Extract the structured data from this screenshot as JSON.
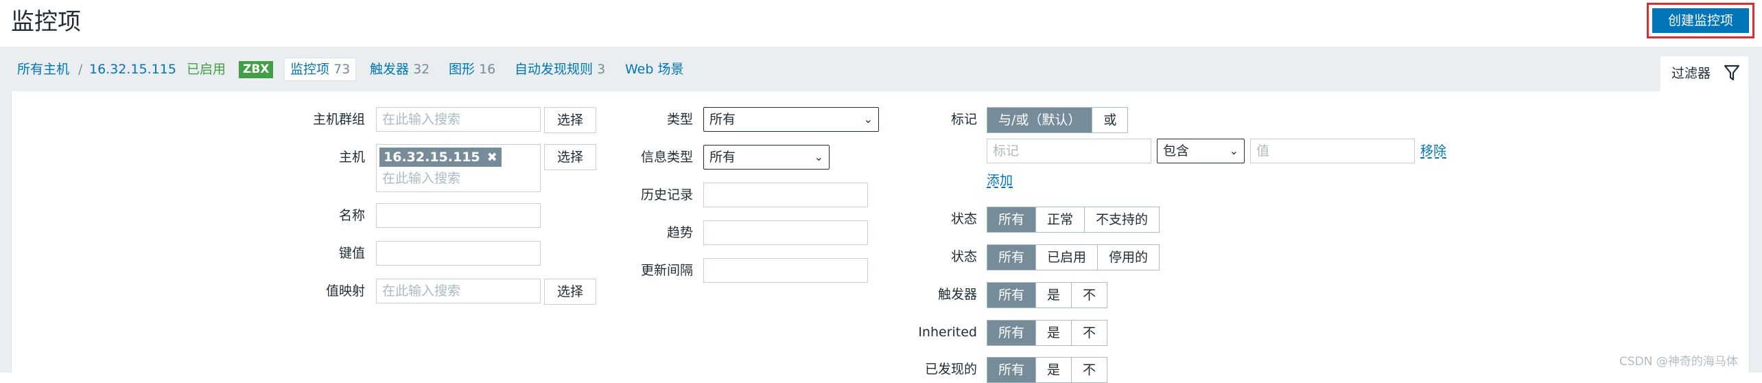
{
  "page": {
    "title": "监控项",
    "create_button": "创建监控项"
  },
  "breadcrumb": {
    "all_hosts": "所有主机",
    "separator": "/",
    "host": "16.32.15.115",
    "status": "已启用",
    "zbx": "ZBX",
    "items_label": "监控项",
    "items_count": "73",
    "triggers_label": "触发器",
    "triggers_count": "32",
    "graphs_label": "图形",
    "graphs_count": "16",
    "discovery_label": "自动发现规则",
    "discovery_count": "3",
    "web_label": "Web 场景"
  },
  "filter": {
    "tab_label": "过滤器",
    "host_group_label": "主机群组",
    "host_group_placeholder": "在此输入搜索",
    "select_label": "选择",
    "host_label": "主机",
    "host_chip": "16.32.15.115",
    "host_placeholder": "在此输入搜索",
    "name_label": "名称",
    "key_label": "键值",
    "valuemap_label": "值映射",
    "valuemap_placeholder": "在此输入搜索",
    "type_label": "类型",
    "type_value": "所有",
    "info_type_label": "信息类型",
    "info_type_value": "所有",
    "history_label": "历史记录",
    "trends_label": "趋势",
    "interval_label": "更新间隔",
    "tags_label": "标记",
    "tags_andor": "与/或（默认）",
    "tags_or": "或",
    "tag_placeholder": "标记",
    "tag_operator": "包含",
    "tag_value_placeholder": "值",
    "remove_label": "移除",
    "add_label": "添加",
    "state_label": "状态",
    "state_options": [
      "所有",
      "正常",
      "不支持的"
    ],
    "status_label": "状态",
    "status_options": [
      "所有",
      "已启用",
      "停用的"
    ],
    "triggers_label": "触发器",
    "triggers_options": [
      "所有",
      "是",
      "不"
    ],
    "inherited_label": "Inherited",
    "inherited_options": [
      "所有",
      "是",
      "不"
    ],
    "discovered_label": "已发现的",
    "discovered_options": [
      "所有",
      "是",
      "不"
    ]
  },
  "watermark": "CSDN @神奇的海马体",
  "colors": {
    "accent": "#0275b8",
    "enabled": "#429e47",
    "highlight": "#e8272e",
    "segment_active": "#768d99"
  }
}
